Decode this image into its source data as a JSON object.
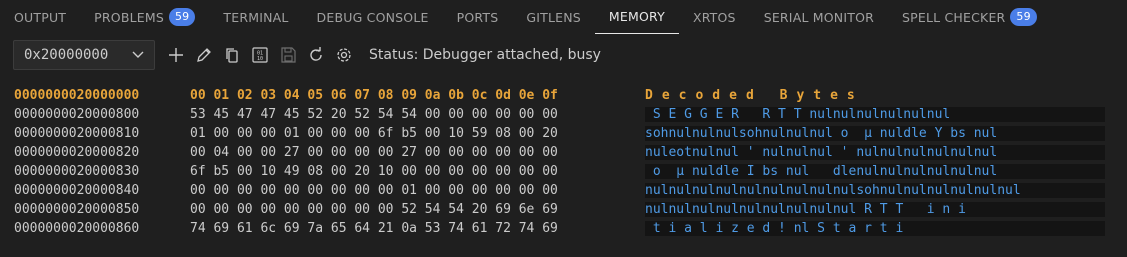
{
  "tabs": [
    {
      "label": "OUTPUT",
      "badge": null,
      "active": false
    },
    {
      "label": "PROBLEMS",
      "badge": "59",
      "active": false
    },
    {
      "label": "TERMINAL",
      "badge": null,
      "active": false
    },
    {
      "label": "DEBUG CONSOLE",
      "badge": null,
      "active": false
    },
    {
      "label": "PORTS",
      "badge": null,
      "active": false
    },
    {
      "label": "GITLENS",
      "badge": null,
      "active": false
    },
    {
      "label": "MEMORY",
      "badge": null,
      "active": true
    },
    {
      "label": "XRTOS",
      "badge": null,
      "active": false
    },
    {
      "label": "SERIAL MONITOR",
      "badge": null,
      "active": false
    },
    {
      "label": "SPELL CHECKER",
      "badge": "59",
      "active": false
    }
  ],
  "toolbar": {
    "address": "0x20000000",
    "status": "Status: Debugger attached, busy",
    "icons": [
      "add-icon",
      "edit-icon",
      "copy-icon",
      "binary-icon",
      "save-icon",
      "refresh-icon",
      "settings-icon"
    ]
  },
  "memory": {
    "header": {
      "address": "0000000020000000",
      "hex": "00 01 02 03 04 05 06 07 08 09 0a 0b 0c 0d 0e 0f",
      "decoded": "Decoded Bytes"
    },
    "rows": [
      {
        "address": "0000000020000800",
        "hex": "53 45 47 47 45 52 20 52 54 54 00 00 00 00 00 00",
        "decoded": " S E G G E R   R T T nulnulnulnulnulnul"
      },
      {
        "address": "0000000020000810",
        "hex": "01 00 00 00 01 00 00 00 6f b5 00 10 59 08 00 20",
        "decoded": "sohnulnulnulsohnulnulnul o  µ nuldle Y bs nul"
      },
      {
        "address": "0000000020000820",
        "hex": "00 04 00 00 27 00 00 00 00 27 00 00 00 00 00 00",
        "decoded": "nuleotnulnul ' nulnulnul ' nulnulnulnulnulnul"
      },
      {
        "address": "0000000020000830",
        "hex": "6f b5 00 10 49 08 00 20 10 00 00 00 00 00 00 00",
        "decoded": " o  µ nuldle I bs nul   dlenulnulnulnulnulnul"
      },
      {
        "address": "0000000020000840",
        "hex": "00 00 00 00 00 00 00 00 00 01 00 00 00 00 00 00",
        "decoded": "nulnulnulnulnulnulnulnulnulsohnulnulnulnulnulnul"
      },
      {
        "address": "0000000020000850",
        "hex": "00 00 00 00 00 00 00 00 00 52 54 54 20 69 6e 69",
        "decoded": "nulnulnulnulnulnulnulnulnul R T T   i n i"
      },
      {
        "address": "0000000020000860",
        "hex": "74 69 61 6c 69 7a 65 64 21 0a 53 74 61 72 74 69",
        "decoded": " t i a l i z e d ! nl S t a r t i"
      }
    ]
  }
}
